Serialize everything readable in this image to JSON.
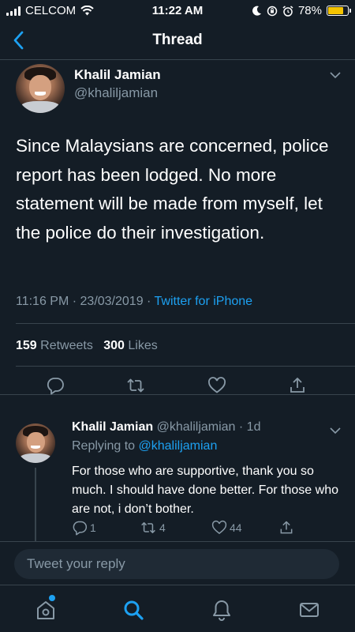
{
  "status_bar": {
    "carrier": "CELCOM",
    "time": "11:22 AM",
    "battery_percent": "78%",
    "battery_level": 0.78
  },
  "header": {
    "title": "Thread",
    "back_icon": "chevron-left-icon"
  },
  "main_tweet": {
    "author_name": "Khalil Jamian",
    "author_handle": "@khaliljamian",
    "text": "Since Malaysians are concerned, police report has been lodged. No more statement will be made from myself, let the police do their investigation.",
    "timestamp": "11:16 PM · 23/03/2019 · ",
    "source": "Twitter for iPhone",
    "retweets_count": "159",
    "retweets_label": "Retweets",
    "likes_count": "300",
    "likes_label": "Likes"
  },
  "reply_tweet": {
    "author_name": "Khalil Jamian",
    "author_handle": "@khaliljamian",
    "time_ago": "· 1d",
    "replying_to_label": "Replying to",
    "replying_to_handle": "@khaliljamian",
    "text": "For those who are supportive, thank you so much. I should have done better. For those who are not, i don’t bother.",
    "reply_count": "1",
    "retweet_count": "4",
    "like_count": "44"
  },
  "compose": {
    "placeholder": "Tweet your reply"
  },
  "colors": {
    "background": "#141d26",
    "accent": "#1da1f2",
    "muted": "#8899a6",
    "divider": "#38444d"
  },
  "tabs": [
    "home-icon",
    "search-icon",
    "bell-icon",
    "mail-icon"
  ]
}
